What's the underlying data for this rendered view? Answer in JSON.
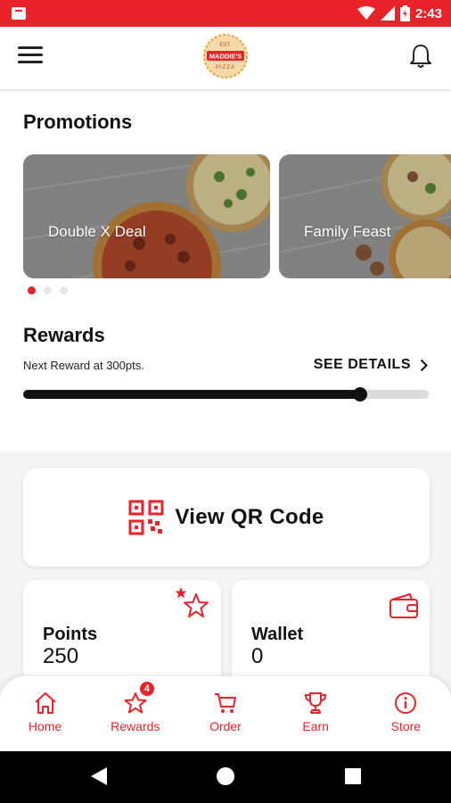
{
  "status_bar": {
    "time": "2:43",
    "bg_color": "#e8232a"
  },
  "header": {
    "logo_top": "EST.",
    "logo_name": "MADDIE'S",
    "logo_sub": "PIZZA"
  },
  "promotions": {
    "title": "Promotions",
    "cards": [
      {
        "label": "Double X Deal"
      },
      {
        "label": "Family Feast"
      }
    ],
    "page_count": 3,
    "active_page": 0
  },
  "rewards": {
    "title": "Rewards",
    "next_reward_text": "Next Reward at 300pts.",
    "see_details_label": "SEE DETAILS",
    "progress_fraction": 0.83
  },
  "qr": {
    "label": "View QR Code"
  },
  "stats": {
    "points": {
      "label": "Points",
      "value": "250"
    },
    "wallet": {
      "label": "Wallet",
      "value": "0"
    }
  },
  "bottom_nav": {
    "items": [
      {
        "label": "Home",
        "icon": "home-icon"
      },
      {
        "label": "Rewards",
        "icon": "star-icon",
        "badge": "4"
      },
      {
        "label": "Order",
        "icon": "cart-icon"
      },
      {
        "label": "Earn",
        "icon": "trophy-icon"
      },
      {
        "label": "Store",
        "icon": "info-icon"
      }
    ]
  },
  "colors": {
    "accent": "#e8232a",
    "text": "#111111"
  }
}
